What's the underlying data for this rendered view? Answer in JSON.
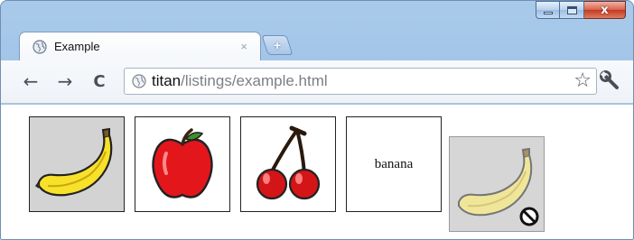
{
  "window": {
    "controls": [
      "minimize",
      "maximize",
      "close"
    ],
    "close_glyph": "x"
  },
  "tab": {
    "title": "Example",
    "close_glyph": "×",
    "icon": "globe-icon",
    "newtab_glyph": "+"
  },
  "toolbar": {
    "back_glyph": "←",
    "forward_glyph": "→",
    "reload_glyph": "C",
    "url_host": "titan",
    "url_path": "/listings/example.html",
    "star_glyph": "☆"
  },
  "content": {
    "tiles": [
      {
        "kind": "image",
        "icon": "banana-icon",
        "selected": true
      },
      {
        "kind": "image",
        "icon": "apple-icon"
      },
      {
        "kind": "image",
        "icon": "cherries-icon"
      },
      {
        "kind": "text",
        "label": "banana"
      },
      {
        "kind": "drag-image",
        "icon": "banana-icon",
        "cursor": "no-drop-icon"
      }
    ]
  },
  "colors": {
    "frame": "#9fc3e7",
    "close_button": "#c23b24",
    "selected_tile": "#d3d3d3",
    "url_path": "#7a7f86"
  }
}
